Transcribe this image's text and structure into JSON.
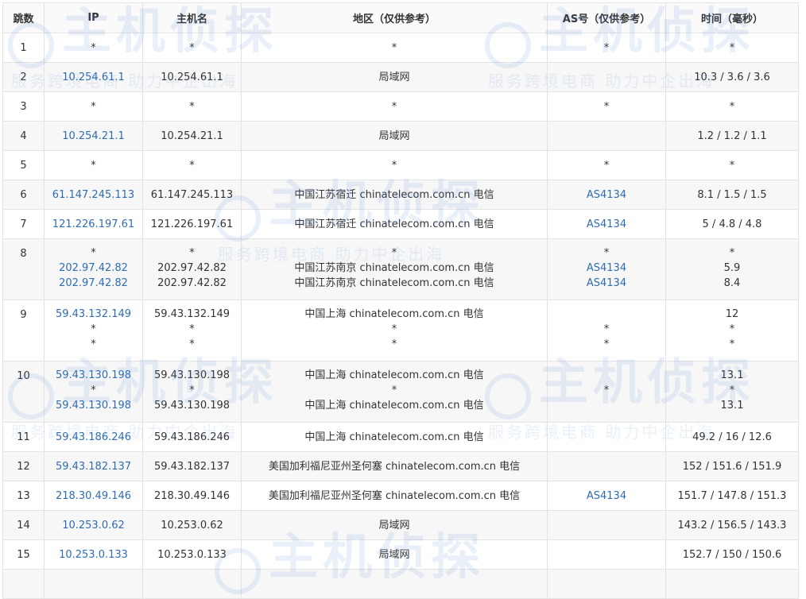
{
  "headers": [
    "跳数",
    "IP",
    "主机名",
    "地区（仅供参考）",
    "AS号（仅供参考）",
    "时间（毫秒）"
  ],
  "watermark": {
    "logo": "主机侦探",
    "slogan": "服务跨境电商 助力中企出海"
  },
  "rows": [
    {
      "hop": "1",
      "lines": [
        {
          "ip": "*",
          "host": "*",
          "region": "*",
          "as": "*",
          "time": "*"
        }
      ]
    },
    {
      "hop": "2",
      "lines": [
        {
          "ip": "10.254.61.1",
          "host": "10.254.61.1",
          "region": "局域网",
          "as": "",
          "time": "10.3 / 3.6 / 3.6"
        }
      ]
    },
    {
      "hop": "3",
      "lines": [
        {
          "ip": "*",
          "host": "*",
          "region": "*",
          "as": "*",
          "time": "*"
        }
      ]
    },
    {
      "hop": "4",
      "lines": [
        {
          "ip": "10.254.21.1",
          "host": "10.254.21.1",
          "region": "局域网",
          "as": "",
          "time": "1.2 / 1.2 / 1.1"
        }
      ]
    },
    {
      "hop": "5",
      "lines": [
        {
          "ip": "*",
          "host": "*",
          "region": "*",
          "as": "*",
          "time": "*"
        }
      ]
    },
    {
      "hop": "6",
      "lines": [
        {
          "ip": "61.147.245.113",
          "host": "61.147.245.113",
          "region": "中国江苏宿迁 chinatelecom.com.cn 电信",
          "as": "AS4134",
          "time": "8.1 / 1.5 / 1.5"
        }
      ]
    },
    {
      "hop": "7",
      "lines": [
        {
          "ip": "121.226.197.61",
          "host": "121.226.197.61",
          "region": "中国江苏宿迁 chinatelecom.com.cn 电信",
          "as": "AS4134",
          "time": "5 / 4.8 / 4.8"
        }
      ]
    },
    {
      "hop": "8",
      "lines": [
        {
          "ip": "*",
          "host": "*",
          "region": "*",
          "as": "*",
          "time": "*"
        },
        {
          "ip": "202.97.42.82",
          "host": "202.97.42.82",
          "region": "中国江苏南京 chinatelecom.com.cn 电信",
          "as": "AS4134",
          "time": "5.9"
        },
        {
          "ip": "202.97.42.82",
          "host": "202.97.42.82",
          "region": "中国江苏南京 chinatelecom.com.cn 电信",
          "as": "AS4134",
          "time": "8.4"
        }
      ]
    },
    {
      "hop": "9",
      "lines": [
        {
          "ip": "59.43.132.149",
          "host": "59.43.132.149",
          "region": "中国上海 chinatelecom.com.cn 电信",
          "as": "",
          "time": "12"
        },
        {
          "ip": "*",
          "host": "*",
          "region": "*",
          "as": "*",
          "time": "*"
        },
        {
          "ip": "*",
          "host": "*",
          "region": "*",
          "as": "*",
          "time": "*"
        }
      ]
    },
    {
      "hop": "10",
      "lines": [
        {
          "ip": "59.43.130.198",
          "host": "59.43.130.198",
          "region": "中国上海 chinatelecom.com.cn 电信",
          "as": "",
          "time": "13.1"
        },
        {
          "ip": "*",
          "host": "*",
          "region": "*",
          "as": "*",
          "time": "*"
        },
        {
          "ip": "59.43.130.198",
          "host": "59.43.130.198",
          "region": "中国上海 chinatelecom.com.cn 电信",
          "as": "",
          "time": "13.1"
        }
      ]
    },
    {
      "hop": "11",
      "lines": [
        {
          "ip": "59.43.186.246",
          "host": "59.43.186.246",
          "region": "中国上海 chinatelecom.com.cn 电信",
          "as": "",
          "time": "49.2 / 16 / 12.6"
        }
      ]
    },
    {
      "hop": "12",
      "lines": [
        {
          "ip": "59.43.182.137",
          "host": "59.43.182.137",
          "region": "美国加利福尼亚州圣何塞 chinatelecom.com.cn 电信",
          "as": "",
          "time": "152 / 151.6 / 151.9"
        }
      ]
    },
    {
      "hop": "13",
      "lines": [
        {
          "ip": "218.30.49.146",
          "host": "218.30.49.146",
          "region": "美国加利福尼亚州圣何塞 chinatelecom.com.cn 电信",
          "as": "AS4134",
          "time": "151.7 / 147.8 / 151.3"
        }
      ]
    },
    {
      "hop": "14",
      "lines": [
        {
          "ip": "10.253.0.62",
          "host": "10.253.0.62",
          "region": "局域网",
          "as": "",
          "time": "143.2 / 156.5 / 143.3"
        }
      ]
    },
    {
      "hop": "15",
      "lines": [
        {
          "ip": "10.253.0.133",
          "host": "10.253.0.133",
          "region": "局域网",
          "as": "",
          "time": "152.7 / 150 / 150.6"
        }
      ]
    },
    {
      "hop": "",
      "lines": [
        {
          "ip": "",
          "host": "",
          "region": "",
          "as": "",
          "time": ""
        }
      ]
    }
  ]
}
